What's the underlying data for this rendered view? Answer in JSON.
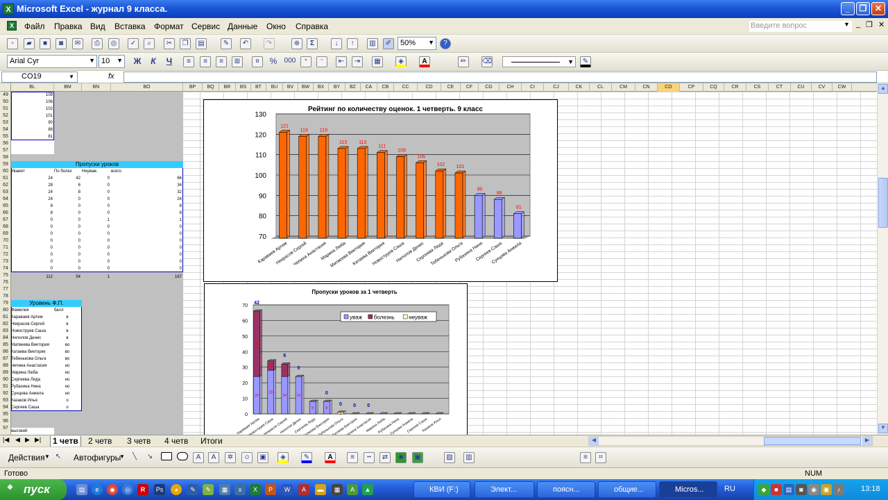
{
  "window": {
    "title": "Microsoft Excel - журнал 9 класса."
  },
  "menu": {
    "items": [
      "Файл",
      "Правка",
      "Вид",
      "Вставка",
      "Формат",
      "Сервис",
      "Данные",
      "Окно",
      "Справка"
    ],
    "help_placeholder": "Введите вопрос"
  },
  "toolbar": {
    "zoom": "50%",
    "font": "Arial Cyr",
    "size": "10",
    "bold": "Ж",
    "italic": "К",
    "underline": "Ч",
    "percent": "%",
    "thousands": "000",
    "sigma": "Σ"
  },
  "formula_bar": {
    "name_box": "CO19",
    "fx": "fx",
    "content": ""
  },
  "columns": [
    "BL",
    "BM",
    "BN",
    "BO",
    "BP",
    "BQ",
    "BR",
    "BS",
    "BT",
    "BU",
    "BV",
    "BW",
    "BX",
    "BY",
    "BZ",
    "CA",
    "CB",
    "CC",
    "CD",
    "CE",
    "CF",
    "CG",
    "CH",
    "CI",
    "CJ",
    "CK",
    "CL",
    "CM",
    "CN",
    "CO",
    "CP",
    "CQ",
    "CR",
    "CS",
    "CT",
    "CU",
    "CV",
    "CW"
  ],
  "rows": [
    "49",
    "50",
    "51",
    "52",
    "53",
    "54",
    "55",
    "56",
    "57",
    "58",
    "59",
    "60",
    "61",
    "62",
    "63",
    "64",
    "65",
    "66",
    "67",
    "68",
    "69",
    "70",
    "71",
    "72",
    "73",
    "74",
    "75",
    "76",
    "77",
    "78",
    "79",
    "80",
    "81",
    "82",
    "83",
    "84",
    "85",
    "86",
    "87",
    "88",
    "89",
    "90",
    "91",
    "92",
    "93",
    "94",
    "95",
    "96",
    "97"
  ],
  "top_values": [
    "108",
    "106",
    "102",
    "101",
    "90",
    "88",
    "81"
  ],
  "absences": {
    "title": "Пропуски уроков",
    "headers": [
      "Уважит",
      "По болез",
      "Неуваж.",
      "всего"
    ],
    "rows": [
      [
        "24",
        "42",
        "0",
        "66"
      ],
      [
        "28",
        "6",
        "0",
        "34"
      ],
      [
        "24",
        "8",
        "0",
        "32"
      ],
      [
        "24",
        "0",
        "0",
        "24"
      ],
      [
        "8",
        "0",
        "0",
        "8"
      ],
      [
        "8",
        "0",
        "0",
        "8"
      ],
      [
        "0",
        "0",
        "1",
        "1"
      ],
      [
        "0",
        "0",
        "0",
        "0"
      ],
      [
        "0",
        "0",
        "0",
        "0"
      ],
      [
        "0",
        "0",
        "0",
        "0"
      ],
      [
        "0",
        "0",
        "0",
        "0"
      ],
      [
        "0",
        "0",
        "0",
        "0"
      ],
      [
        "0",
        "0",
        "0",
        "0"
      ],
      [
        "0",
        "0",
        "0",
        "0"
      ]
    ],
    "totals": [
      "112",
      "54",
      "1",
      "167"
    ]
  },
  "level": {
    "title": "Уровень Ф.П.",
    "headers": [
      "Фамилия",
      "балл"
    ],
    "rows": [
      [
        "Каравaев Артем",
        "в"
      ],
      [
        "Некрасов Сергей",
        "в"
      ],
      [
        "Новоструев Саша",
        "в"
      ],
      [
        "Нилолов Денис",
        "в"
      ],
      [
        "Матвеева Виктория",
        "во"
      ],
      [
        "Катаева Викторке",
        "во"
      ],
      [
        "Тебенькова Ольга",
        "во"
      ],
      [
        "Чепина Анастасия",
        "но"
      ],
      [
        "Марина Люба",
        "но"
      ],
      [
        "Сергеева Лида",
        "но"
      ],
      [
        "Рубахина Нина",
        "но"
      ],
      [
        "Сунцова Анжела",
        "но"
      ],
      [
        "Казаков Илья",
        "о"
      ],
      [
        "Сергеев Саша",
        "о"
      ]
    ],
    "bottom_label": "высокий"
  },
  "chart_data": [
    {
      "type": "bar",
      "title": "Рейтинг по количеству оценок. 1 четверть. 9 класс",
      "categories": [
        "Каравaев Артем",
        "Некрасов Сергей",
        "Чепина Анастасия",
        "Марина Люба",
        "Матвеева Виктория",
        "Катаева Виктория",
        "Новоструев Саша",
        "Нилолов Денис",
        "Сергеева Лида",
        "Тебенькова Ольга",
        "Рубахина Нина",
        "Сергеев Саша",
        "Сунцова Анжела"
      ],
      "values": [
        121,
        119,
        119,
        113,
        113,
        111,
        109,
        106,
        102,
        101,
        90,
        88,
        81
      ],
      "ylim": [
        70,
        130
      ],
      "yticks": [
        "130",
        "120",
        "110",
        "100",
        "90",
        "80",
        "70"
      ],
      "colors": [
        "#ff6600",
        "#ff6600",
        "#ff6600",
        "#ff6600",
        "#ff6600",
        "#ff6600",
        "#ff6600",
        "#ff6600",
        "#ff6600",
        "#ff6600",
        "#9999ff",
        "#9999ff",
        "#9999ff"
      ],
      "grid": true
    },
    {
      "type": "bar",
      "title": "Пропуски уроков за 1 четверть",
      "stacked": true,
      "categories": [
        "Каравaев Артем",
        "Новоструев Саша",
        "Некрасов Сергей",
        "Нилолов Денис",
        "Сергеева Лида",
        "Матвеева Виктория",
        "Тебенькова Ольга",
        "Катаева Виктория",
        "Чепина Анастасия",
        "Марина Люба",
        "Рубахина Нина",
        "Сунцова Анжела",
        "Сергеев Саша",
        "Казаков Илья"
      ],
      "series": [
        {
          "name": "уваж",
          "values": [
            24,
            28,
            24,
            24,
            8,
            8,
            0,
            0,
            0,
            0,
            0,
            0,
            0,
            0
          ],
          "color": "#9999ff"
        },
        {
          "name": "болезнь",
          "values": [
            42,
            6,
            8,
            0,
            0,
            0,
            0,
            0,
            0,
            0,
            0,
            0,
            0,
            0
          ],
          "color": "#993366"
        },
        {
          "name": "неуваж",
          "values": [
            0,
            0,
            0,
            0,
            0,
            0,
            1,
            0,
            0,
            0,
            0,
            0,
            0,
            0
          ],
          "color": "#ffffcc"
        }
      ],
      "top_labels": [
        "42",
        "",
        "6",
        "0",
        "",
        "0",
        "0",
        "0",
        "0",
        "",
        "",
        "",
        "",
        ""
      ],
      "ylim": [
        0,
        70
      ],
      "yticks": [
        "70",
        "60",
        "50",
        "40",
        "30",
        "20",
        "10",
        "0"
      ],
      "legend": "top-right",
      "grid": true
    }
  ],
  "sheets": [
    "1 четв",
    "2 четв",
    "3 четв",
    "4 четв",
    "Итоги"
  ],
  "draw": {
    "actions": "Действия",
    "autoshapes": "Автофигуры"
  },
  "status": {
    "ready": "Готово",
    "num": "NUM"
  },
  "taskbar": {
    "start": "пуск",
    "tasks": [
      "КВИ (F:)",
      "Элект...",
      "поясн...",
      "общие...",
      "Micros..."
    ],
    "lang": "RU",
    "clock": "13:18"
  }
}
